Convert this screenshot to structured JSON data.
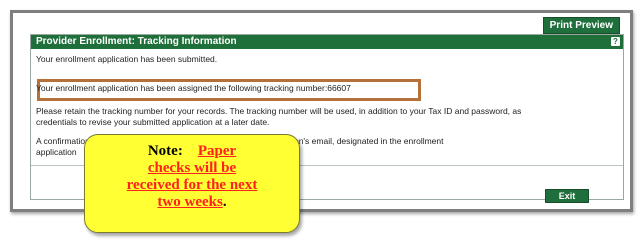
{
  "toolbar": {
    "print_preview_label": "Print Preview"
  },
  "panel": {
    "title": "Provider Enrollment: Tracking Information",
    "help_icon": "?",
    "submitted_msg": "Your enrollment application has been submitted.",
    "tracking_msg": "Your enrollment application has been assigned the following tracking number:66607",
    "retain_msg_line1": "Please retain the tracking number for your records. The tracking number will be used, in addition to your Tax ID and password, as",
    "retain_msg_line2": "credentials to revise your submitted application at a later date.",
    "email_msg_line1": "A confirmation email has also been sent to the following contact person's email, designated in the enrollment",
    "email_msg_line2": "application",
    "exit_label": "Exit"
  },
  "note": {
    "label": "Note:",
    "line1": "Paper",
    "line2": "checks will be",
    "line3": "received for the next",
    "line4": "two weeks",
    "period": "."
  },
  "colors": {
    "header_green": "#1f6f3a",
    "highlight_border": "#b5713a",
    "note_yellow": "#ffff33",
    "note_red_text": "#ff2020"
  }
}
